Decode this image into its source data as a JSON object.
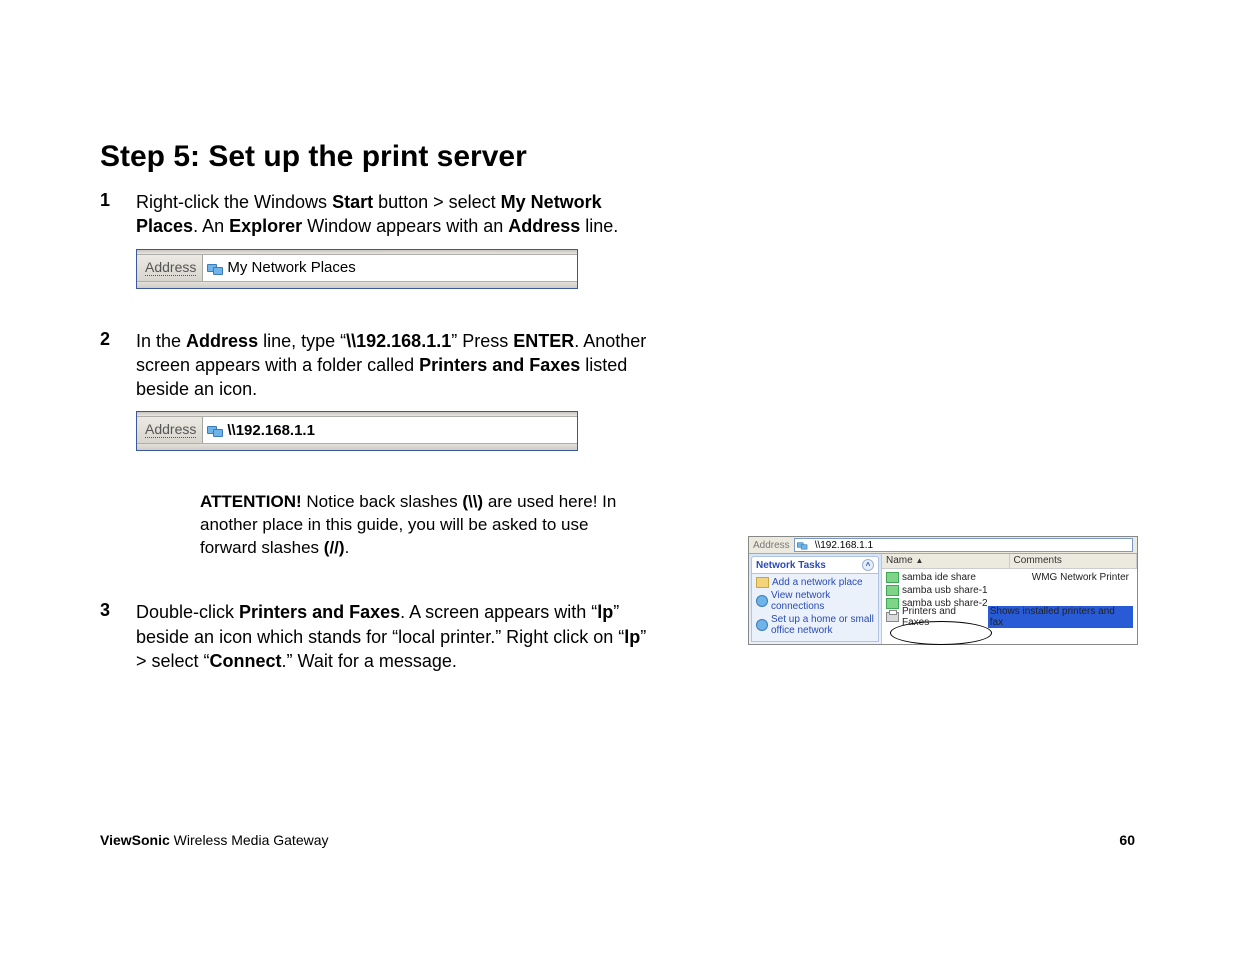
{
  "title": "Step 5:  Set up the print server",
  "step1": {
    "num": "1",
    "pre": "Right-click the Windows ",
    "b1": "Start",
    "mid1": " button > select ",
    "b2": "My Network Places",
    "mid2": ". An ",
    "b3": "Explorer",
    "mid3": " Window appears with an ",
    "b4": "Address",
    "post": " line."
  },
  "addr1": {
    "label": "Address",
    "value": "My Network Places"
  },
  "step2": {
    "num": "2",
    "pre": "In the ",
    "b1": "Address",
    "mid1": " line, type “",
    "b2": "\\\\192.168.1.1",
    "mid2": "”  Press ",
    "b3": "ENTER",
    "mid3": ". Another screen appears with a folder called ",
    "b4": "Printers and Faxes",
    "post": " listed beside an icon."
  },
  "addr2": {
    "label": "Address",
    "value": "\\\\192.168.1.1"
  },
  "attention": {
    "b1": "ATTENTION!",
    "t1": " Notice back slashes ",
    "b2": "(\\\\)",
    "t2": " are used here! In another place in this guide, you will be asked to use forward slashes ",
    "b3": "(//)",
    "t3": "."
  },
  "step3": {
    "num": "3",
    "pre": "Double-click ",
    "b1": "Printers and Faxes",
    "mid1": ". A screen appears with “",
    "b2": "lp",
    "mid2": "” beside an icon which stands for “local printer.” Right click on “",
    "b3": "lp",
    "mid3": "” > select “",
    "b4": "Connect",
    "post": ".” Wait for a message."
  },
  "explorer": {
    "addr_label": "Address",
    "addr_value": "\\\\192.168.1.1",
    "tasks_title": "Network Tasks",
    "task1": "Add a network place",
    "task2": "View network connections",
    "task3": "Set up a home or small office network",
    "col_name": "Name",
    "col_comments": "Comments",
    "row1": "samba ide share",
    "row1_cmt": "WMG Network Printer",
    "row2": "samba usb share-1",
    "row3": "samba usb share-2",
    "row4": "Printers and Faxes",
    "row4_cmt": "Shows installed printers and fax"
  },
  "footer": {
    "brand": "ViewSonic",
    "product": " Wireless Media Gateway",
    "page": "60"
  }
}
